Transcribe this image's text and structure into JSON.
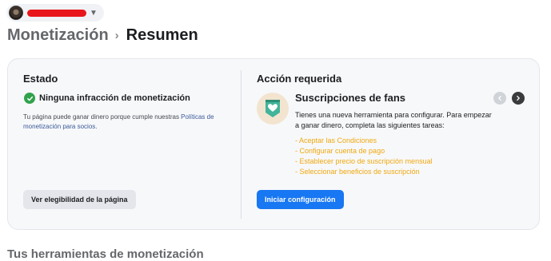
{
  "header": {
    "breadcrumb_parent": "Monetización",
    "breadcrumb_current": "Resumen"
  },
  "status": {
    "title": "Estado",
    "status_text": "Ninguna infracción de monetización",
    "description": "Tu página puede ganar dinero porque cumple nuestras ",
    "policy_link": "Políticas de monetización para socios",
    "description_end": ".",
    "eligibility_button": "Ver elegibilidad de la página"
  },
  "action": {
    "title": "Acción requerida",
    "tool_title": "Suscripciones de fans",
    "tool_description": "Tienes una nueva herramienta para configurar. Para empezar a ganar dinero, completa las siguientes tareas:",
    "tasks": [
      "- Aceptar las Condiciones",
      "- Configurar cuenta de pago",
      "- Establecer precio de suscripción mensual",
      "- Seleccionar beneficios de suscripción"
    ],
    "start_button": "Iniciar configuración"
  },
  "bottom": {
    "title": "Tus herramientas de monetización"
  },
  "colors": {
    "accent": "#1877f2",
    "success": "#31a24c",
    "task_link": "#f0a80e"
  }
}
